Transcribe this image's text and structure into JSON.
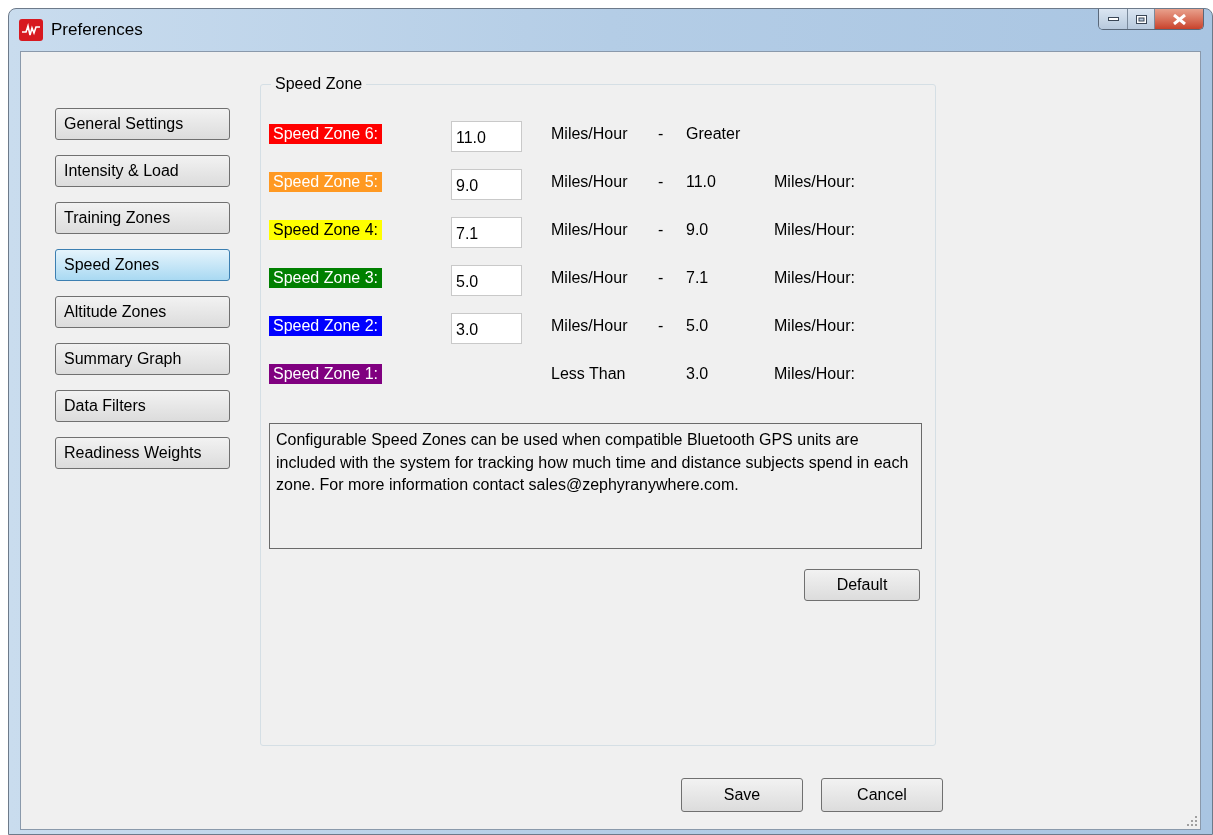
{
  "window": {
    "title": "Preferences"
  },
  "sidebar": {
    "items": [
      {
        "label": "General Settings",
        "selected": false
      },
      {
        "label": "Intensity & Load",
        "selected": false
      },
      {
        "label": "Training Zones",
        "selected": false
      },
      {
        "label": "Speed Zones",
        "selected": true
      },
      {
        "label": "Altitude Zones",
        "selected": false
      },
      {
        "label": "Summary Graph",
        "selected": false
      },
      {
        "label": "Data Filters",
        "selected": false
      },
      {
        "label": "Readiness Weights",
        "selected": false
      }
    ]
  },
  "group": {
    "title": "Speed Zone",
    "zones": [
      {
        "label": "Speed Zone 6:",
        "color": "#ff0000",
        "value": "11.0",
        "unit": "Miles/Hour",
        "dash": "-",
        "bound": "Greater"
      },
      {
        "label": "Speed Zone 5:",
        "color": "#ff9922",
        "value": "9.0",
        "unit": "Miles/Hour",
        "dash": "-",
        "bound": "11.0",
        "bound_unit": "Miles/Hour:"
      },
      {
        "label": "Speed Zone 4:",
        "color": "#ffff00",
        "value": "7.1",
        "unit": "Miles/Hour",
        "dash": "-",
        "bound": "9.0",
        "bound_unit": "Miles/Hour:"
      },
      {
        "label": "Speed Zone 3:",
        "color": "#008000",
        "value": "5.0",
        "unit": "Miles/Hour",
        "dash": "-",
        "bound": "7.1",
        "bound_unit": "Miles/Hour:"
      },
      {
        "label": "Speed Zone 2:",
        "color": "#0000ff",
        "value": "3.0",
        "unit": "Miles/Hour",
        "dash": "-",
        "bound": "5.0",
        "bound_unit": "Miles/Hour:"
      },
      {
        "label": "Speed Zone 1:",
        "color": "#800080",
        "unit": "Less Than",
        "bound": "3.0",
        "bound_unit": "Miles/Hour:"
      }
    ],
    "description": "Configurable Speed Zones can be used when compatible Bluetooth GPS units are included with the system for tracking how much time and distance subjects spend in each zone.  For more information contact sales@zephyranywhere.com.",
    "default_button": "Default"
  },
  "buttons": [
    "Save",
    "Cancel"
  ]
}
